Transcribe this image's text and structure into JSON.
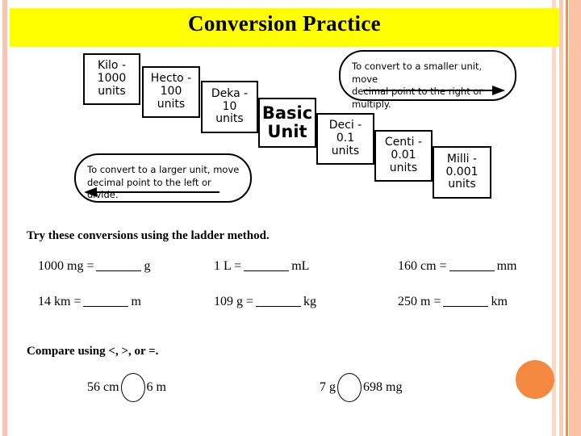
{
  "slide": {
    "title": "Conversion Practice",
    "title_bg_color": "#ffff00",
    "background_color": "#ffffff"
  },
  "decor": {
    "left_strip_color": "#f7c4ad",
    "right_strip_colors": [
      "#fad9c8",
      "#f8cdb8",
      "#ef8f52",
      "#fac3a6"
    ],
    "orange_dot_color": "#f5893f"
  },
  "ladder": {
    "steps": [
      {
        "name": "kilo",
        "label": "Kilo -\n1000\nunits"
      },
      {
        "name": "hecto",
        "label": "Hecto -\n100\nunits"
      },
      {
        "name": "deka",
        "label": "Deka -\n10\nunits"
      },
      {
        "name": "basic",
        "label": "Basic\nUnit"
      },
      {
        "name": "deci",
        "label": "Deci -\n0.1\nunits"
      },
      {
        "name": "centi",
        "label": "Centi -\n0.01\nunits"
      },
      {
        "name": "milli",
        "label": "Milli -\n0.001\nunits"
      }
    ],
    "callout_left": "To convert to a larger unit, move\ndecimal  point to the left or divide.",
    "callout_right": "To convert to a smaller unit, move\ndecimal  point to the right or multiply."
  },
  "conversions": {
    "heading": "Try these conversions using the ladder method.",
    "items": [
      {
        "prefix": "1000 mg =",
        "suffix": "g"
      },
      {
        "prefix": "1 L =",
        "suffix": "mL"
      },
      {
        "prefix": "160 cm =",
        "suffix": "mm"
      },
      {
        "prefix": "14 km =",
        "suffix": "m"
      },
      {
        "prefix": "109 g =",
        "suffix": "kg"
      },
      {
        "prefix": "250 m =",
        "suffix": "km"
      }
    ]
  },
  "compare": {
    "heading": "Compare using <, >, or =.",
    "items": [
      {
        "left": "56 cm",
        "right": "6 m"
      },
      {
        "left": "7 g",
        "right": "698 mg"
      }
    ]
  }
}
